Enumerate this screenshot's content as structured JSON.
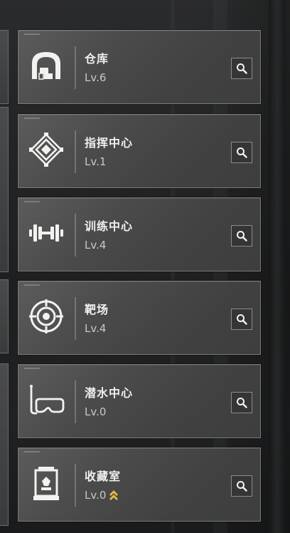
{
  "facilities": [
    {
      "name": "仓库",
      "level": "Lv.6",
      "icon": "warehouse-icon",
      "upgradable": false
    },
    {
      "name": "指挥中心",
      "level": "Lv.1",
      "icon": "command-center-icon",
      "upgradable": false
    },
    {
      "name": "训练中心",
      "level": "Lv.4",
      "icon": "dumbbell-icon",
      "upgradable": false
    },
    {
      "name": "靶场",
      "level": "Lv.4",
      "icon": "target-icon",
      "upgradable": false
    },
    {
      "name": "潜水中心",
      "level": "Lv.0",
      "icon": "diving-mask-icon",
      "upgradable": false
    },
    {
      "name": "收藏室",
      "level": "Lv.0",
      "icon": "collection-case-icon",
      "upgradable": true
    }
  ],
  "colors": {
    "card_bg": "#4a4b4a",
    "card_border": "#7a7b7a",
    "name_text": "#f0f0ee",
    "level_text": "#c9c9c6",
    "upgrade_arrow": "#e6b94a",
    "search_bg": "#343534"
  }
}
